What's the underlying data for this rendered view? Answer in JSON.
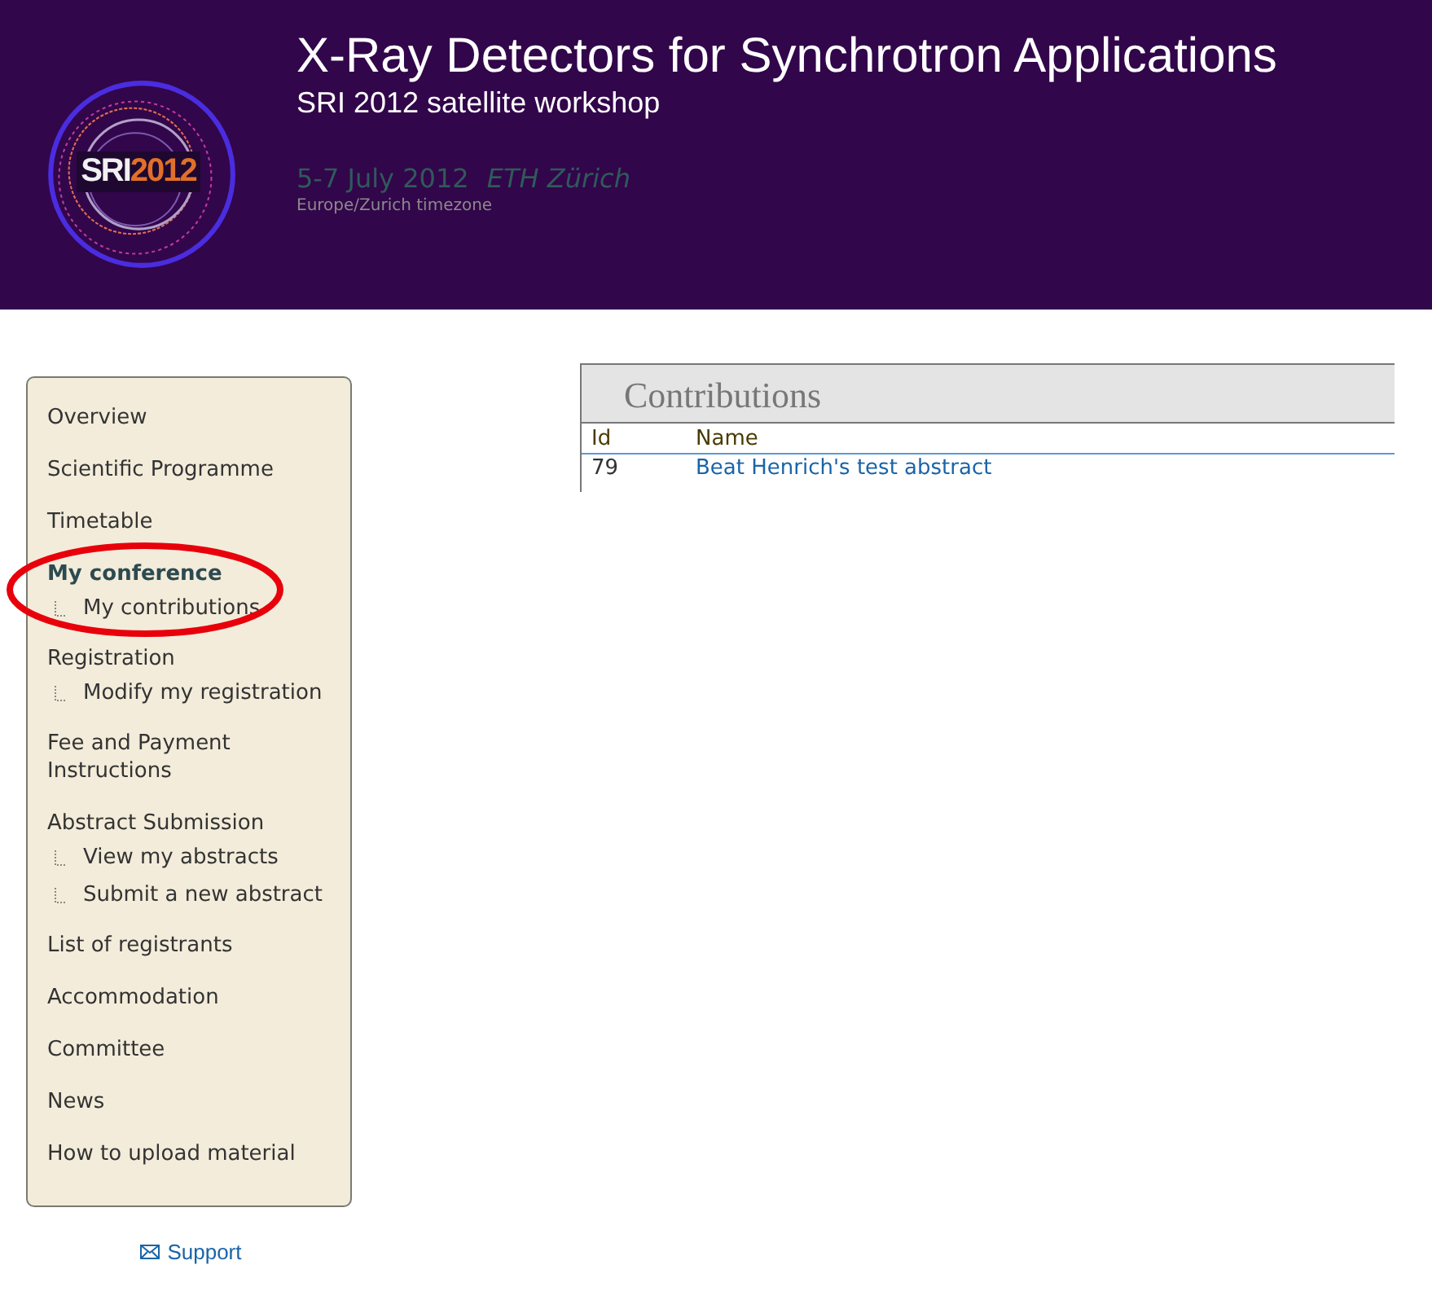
{
  "header": {
    "logo": {
      "part_1": "SRI",
      "part_2": "2012"
    },
    "title": "X-Ray Detectors for Synchrotron Applications",
    "subtitle": "SRI 2012 satellite workshop",
    "date": "5-7 July 2012",
    "venue": "ETH Zürich",
    "timezone": "Europe/Zurich timezone"
  },
  "sidebar": {
    "items": [
      {
        "label": "Overview",
        "selected": false
      },
      {
        "label": "Scientific Programme",
        "selected": false
      },
      {
        "label": "Timetable",
        "selected": false
      },
      {
        "label": "My conference",
        "selected": true,
        "annotated": true,
        "children": [
          {
            "label": "My contributions",
            "selected": false
          }
        ]
      },
      {
        "label": "Registration",
        "selected": false,
        "children": [
          {
            "label": "Modify my registration",
            "selected": false
          }
        ]
      },
      {
        "label": "Fee and Payment Instructions",
        "selected": false
      },
      {
        "label": "Abstract Submission",
        "selected": false,
        "children": [
          {
            "label": "View my abstracts",
            "selected": false
          },
          {
            "label": "Submit a new abstract",
            "selected": false
          }
        ]
      },
      {
        "label": "List of registrants",
        "selected": false
      },
      {
        "label": "Accommodation",
        "selected": false
      },
      {
        "label": "Committee",
        "selected": false
      },
      {
        "label": "News",
        "selected": false
      },
      {
        "label": "How to upload material",
        "selected": false
      }
    ]
  },
  "support_link": "Support",
  "contributions": {
    "title": "Contributions",
    "columns": [
      "Id",
      "Name"
    ],
    "rows": [
      {
        "id": "79",
        "name": "Beat Henrich's test abstract"
      }
    ]
  }
}
